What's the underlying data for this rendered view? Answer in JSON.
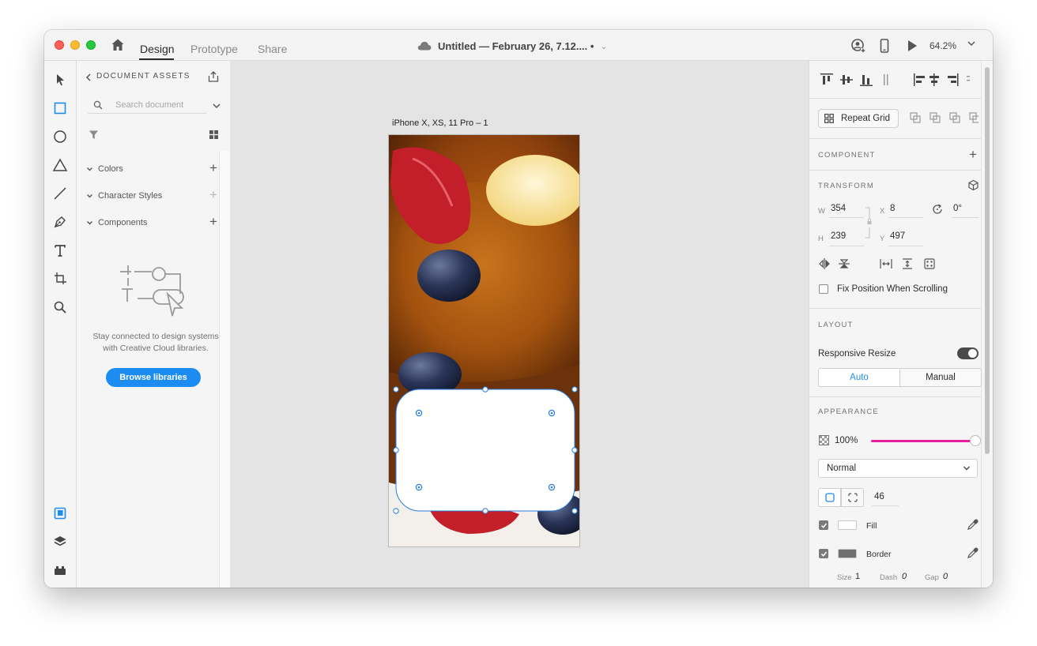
{
  "titlebar": {
    "tabs": [
      {
        "label": "Design",
        "active": true
      },
      {
        "label": "Prototype",
        "active": false
      },
      {
        "label": "Share",
        "active": false
      }
    ],
    "document_title": "Untitled — February 26, 7.12.... •",
    "zoom": "64.2%",
    "icons": [
      "home-icon",
      "cloud-icon",
      "user-add-icon",
      "mobile-preview-icon",
      "play-icon",
      "chevron-down-icon"
    ]
  },
  "tools": [
    "select-tool",
    "rectangle-tool",
    "ellipse-tool",
    "polygon-tool",
    "line-tool",
    "pen-tool",
    "text-tool",
    "artboard-tool",
    "zoom-tool",
    "assets",
    "layers",
    "plugins"
  ],
  "assets_panel": {
    "heading": "DOCUMENT ASSETS",
    "search_placeholder": "Search document",
    "sections": [
      {
        "label": "Colors",
        "add_enabled": true
      },
      {
        "label": "Character Styles",
        "add_enabled": false
      },
      {
        "label": "Components",
        "add_enabled": true
      }
    ],
    "empty_text": "Stay connected to design systems with Creative Cloud libraries.",
    "browse_button": "Browse libraries"
  },
  "canvas": {
    "artboard_label": "iPhone X, XS, 11 Pro – 1"
  },
  "inspector": {
    "repeat_grid": "Repeat Grid",
    "component_heading": "COMPONENT",
    "transform_heading": "TRANSFORM",
    "transform": {
      "w_label": "W",
      "w": "354",
      "x_label": "X",
      "x": "8",
      "h_label": "H",
      "h": "239",
      "y_label": "Y",
      "y": "497",
      "rotation": "0°"
    },
    "fix_position": "Fix Position When Scrolling",
    "layout_heading": "LAYOUT",
    "responsive_resize": "Responsive Resize",
    "responsive_on": true,
    "resize_modes": [
      "Auto",
      "Manual"
    ],
    "appearance_heading": "APPEARANCE",
    "opacity": "100%",
    "opacity_fraction": 1.0,
    "blend_mode": "Normal",
    "corner_radius": "46",
    "fill": {
      "label": "Fill",
      "checked": true,
      "color": "#ffffff"
    },
    "border": {
      "label": "Border",
      "checked": true,
      "color": "#707070"
    },
    "border_props": {
      "size_label": "Size",
      "size": "1",
      "dash_label": "Dash",
      "dash": "0",
      "gap_label": "Gap",
      "gap": "0"
    },
    "colors": {
      "accent": "#1c8cf3",
      "opacity_slider": "#e91ea0",
      "selection": "#2a7de1"
    }
  }
}
